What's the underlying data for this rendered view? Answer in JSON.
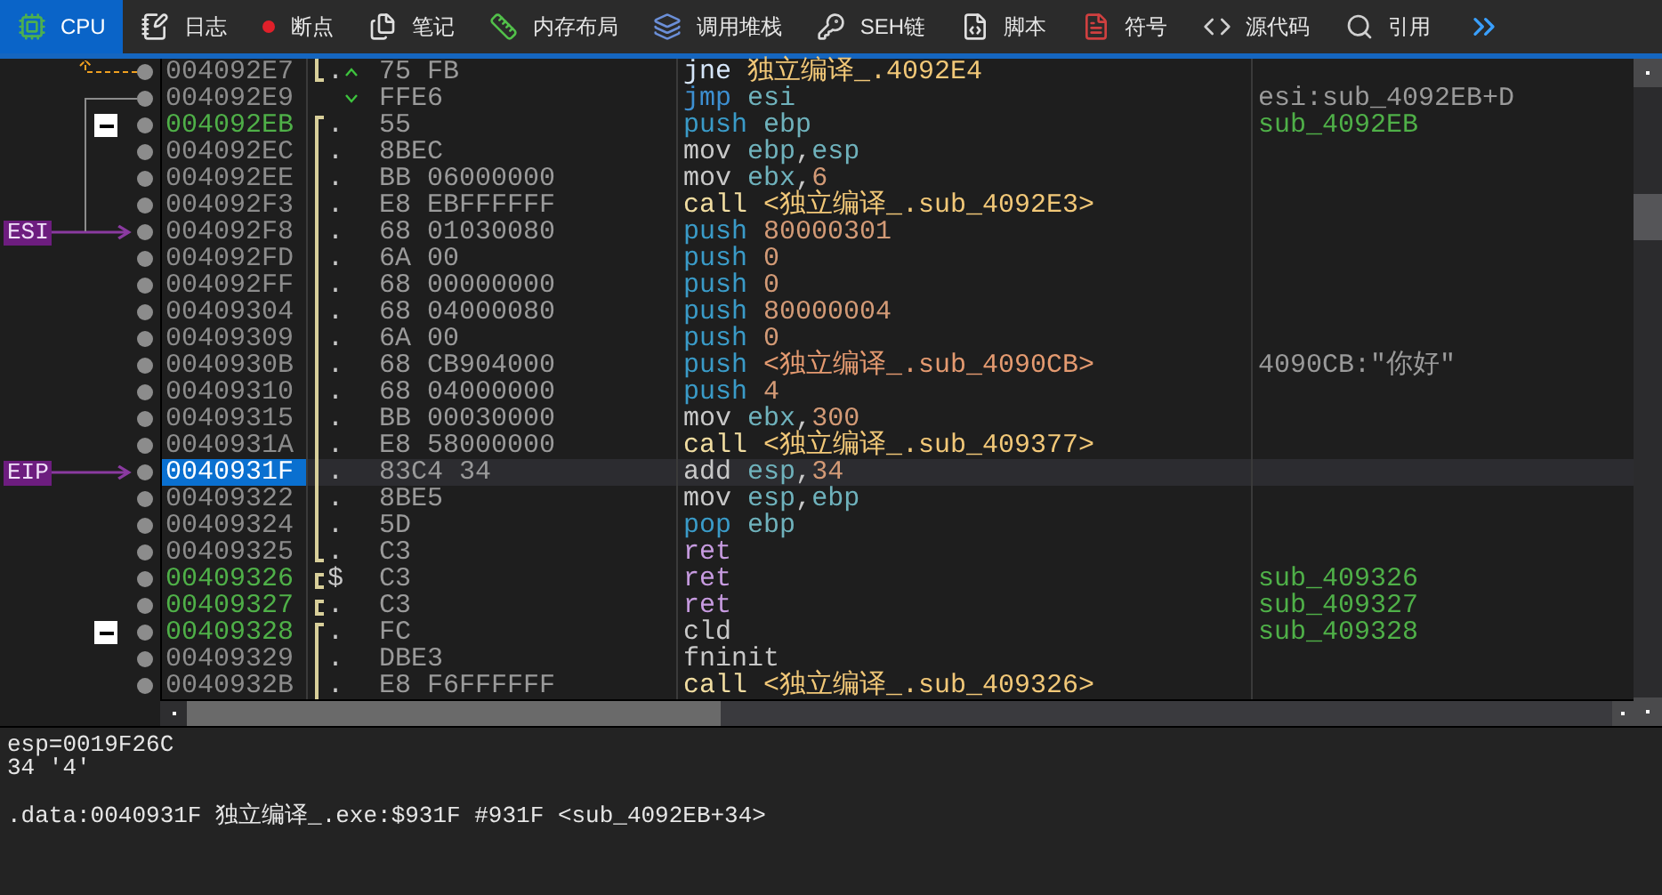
{
  "tabs": [
    {
      "label": "CPU",
      "kind": "cpu",
      "selected": true
    },
    {
      "label": "日志",
      "kind": "log",
      "selected": false
    },
    {
      "label": "断点",
      "kind": "breakpoint",
      "selected": false
    },
    {
      "label": "笔记",
      "kind": "notes",
      "selected": false
    },
    {
      "label": "内存布局",
      "kind": "memory",
      "selected": false
    },
    {
      "label": "调用堆栈",
      "kind": "stack",
      "selected": false
    },
    {
      "label": "SEH链",
      "kind": "seh",
      "selected": false
    },
    {
      "label": "脚本",
      "kind": "script",
      "selected": false
    },
    {
      "label": "符号",
      "kind": "symbol",
      "selected": false
    },
    {
      "label": "源代码",
      "kind": "source",
      "selected": false
    },
    {
      "label": "引用",
      "kind": "references",
      "selected": false
    },
    {
      "kind": "more",
      "selected": false
    }
  ],
  "rows": [
    {
      "address": "004092E7",
      "is_label": false,
      "selected": false,
      "fold": false,
      "bracket": {
        "kind": "end"
      },
      "marker": ".",
      "jump": {
        "kind": "up"
      },
      "bytes": "75 FB",
      "mnemonic": {
        "text": "jne",
        "kind": "cond_jump"
      },
      "operands": [
        {
          "text": "独立编译_.4092E4",
          "kind": "label"
        }
      ]
    },
    {
      "address": "004092E9",
      "is_label": false,
      "selected": false,
      "fold": false,
      "jump": {
        "kind": "down"
      },
      "bytes": "FFE6",
      "mnemonic": {
        "text": "jmp",
        "kind": "jump"
      },
      "operands": [
        {
          "text": "esi",
          "kind": "reg"
        }
      ],
      "comment": {
        "text": "esi:sub_4092EB+D",
        "kind": "plain"
      }
    },
    {
      "address": "004092EB",
      "is_label": true,
      "selected": false,
      "fold": true,
      "bracket": {
        "kind": "start"
      },
      "marker": ".",
      "bytes": "55",
      "mnemonic": {
        "text": "push",
        "kind": "stack"
      },
      "operands": [
        {
          "text": "ebp",
          "kind": "reg"
        }
      ],
      "comment": {
        "text": "sub_4092EB",
        "kind": "label"
      }
    },
    {
      "address": "004092EC",
      "is_label": false,
      "selected": false,
      "fold": false,
      "bracket": {
        "kind": "mid"
      },
      "marker": ".",
      "bytes": "8BEC",
      "mnemonic": {
        "text": "mov",
        "kind": "plain"
      },
      "operands": [
        {
          "text": "ebp",
          "kind": "reg"
        },
        {
          "text": ",",
          "kind": "punct"
        },
        {
          "text": "esp",
          "kind": "reg"
        }
      ]
    },
    {
      "address": "004092EE",
      "is_label": false,
      "selected": false,
      "fold": false,
      "bracket": {
        "kind": "mid"
      },
      "marker": ".",
      "bytes": "BB 06000000",
      "mnemonic": {
        "text": "mov",
        "kind": "plain"
      },
      "operands": [
        {
          "text": "ebx",
          "kind": "reg"
        },
        {
          "text": ",",
          "kind": "punct"
        },
        {
          "text": "6",
          "kind": "num"
        }
      ]
    },
    {
      "address": "004092F3",
      "is_label": false,
      "selected": false,
      "fold": false,
      "bracket": {
        "kind": "mid"
      },
      "marker": ".",
      "bytes": "E8 EBFFFFFF",
      "mnemonic": {
        "text": "call",
        "kind": "call"
      },
      "operands": [
        {
          "text": "<独立编译_.sub_4092E3>",
          "kind": "label"
        }
      ]
    },
    {
      "address": "004092F8",
      "is_label": false,
      "selected": false,
      "fold": false,
      "bracket": {
        "kind": "mid"
      },
      "marker": ".",
      "register": "ESI",
      "bytes": "68 01030080",
      "mnemonic": {
        "text": "push",
        "kind": "stack"
      },
      "operands": [
        {
          "text": "80000301",
          "kind": "num"
        }
      ]
    },
    {
      "address": "004092FD",
      "is_label": false,
      "selected": false,
      "fold": false,
      "bracket": {
        "kind": "mid"
      },
      "marker": ".",
      "bytes": "6A 00",
      "mnemonic": {
        "text": "push",
        "kind": "stack"
      },
      "operands": [
        {
          "text": "0",
          "kind": "num"
        }
      ]
    },
    {
      "address": "004092FF",
      "is_label": false,
      "selected": false,
      "fold": false,
      "bracket": {
        "kind": "mid"
      },
      "marker": ".",
      "bytes": "68 00000000",
      "mnemonic": {
        "text": "push",
        "kind": "stack"
      },
      "operands": [
        {
          "text": "0",
          "kind": "num"
        }
      ]
    },
    {
      "address": "00409304",
      "is_label": false,
      "selected": false,
      "fold": false,
      "bracket": {
        "kind": "mid"
      },
      "marker": ".",
      "bytes": "68 04000080",
      "mnemonic": {
        "text": "push",
        "kind": "stack"
      },
      "operands": [
        {
          "text": "80000004",
          "kind": "num"
        }
      ]
    },
    {
      "address": "00409309",
      "is_label": false,
      "selected": false,
      "fold": false,
      "bracket": {
        "kind": "mid"
      },
      "marker": ".",
      "bytes": "6A 00",
      "mnemonic": {
        "text": "push",
        "kind": "stack"
      },
      "operands": [
        {
          "text": "0",
          "kind": "num"
        }
      ]
    },
    {
      "address": "0040930B",
      "is_label": false,
      "selected": false,
      "fold": false,
      "bracket": {
        "kind": "mid"
      },
      "marker": ".",
      "bytes": "68 CB904000",
      "mnemonic": {
        "text": "push",
        "kind": "stack"
      },
      "operands": [
        {
          "text": "<独立编译_.sub_4090CB>",
          "kind": "address"
        }
      ],
      "comment": {
        "text": "4090CB:\"你好\"",
        "kind": "plain"
      }
    },
    {
      "address": "00409310",
      "is_label": false,
      "selected": false,
      "fold": false,
      "bracket": {
        "kind": "mid"
      },
      "marker": ".",
      "bytes": "68 04000000",
      "mnemonic": {
        "text": "push",
        "kind": "stack"
      },
      "operands": [
        {
          "text": "4",
          "kind": "num"
        }
      ]
    },
    {
      "address": "00409315",
      "is_label": false,
      "selected": false,
      "fold": false,
      "bracket": {
        "kind": "mid"
      },
      "marker": ".",
      "bytes": "BB 00030000",
      "mnemonic": {
        "text": "mov",
        "kind": "plain"
      },
      "operands": [
        {
          "text": "ebx",
          "kind": "reg"
        },
        {
          "text": ",",
          "kind": "punct"
        },
        {
          "text": "300",
          "kind": "num"
        }
      ]
    },
    {
      "address": "0040931A",
      "is_label": false,
      "selected": false,
      "fold": false,
      "bracket": {
        "kind": "mid"
      },
      "marker": ".",
      "bytes": "E8 58000000",
      "mnemonic": {
        "text": "call",
        "kind": "call"
      },
      "operands": [
        {
          "text": "<独立编译_.sub_409377>",
          "kind": "label"
        }
      ]
    },
    {
      "address": "0040931F",
      "is_label": false,
      "selected": true,
      "fold": false,
      "bracket": {
        "kind": "mid"
      },
      "marker": ".",
      "register": "EIP",
      "bytes": "83C4 34",
      "mnemonic": {
        "text": "add",
        "kind": "plain"
      },
      "operands": [
        {
          "text": "esp",
          "kind": "reg"
        },
        {
          "text": ",",
          "kind": "punct"
        },
        {
          "text": "34",
          "kind": "num"
        }
      ]
    },
    {
      "address": "00409322",
      "is_label": false,
      "selected": false,
      "fold": false,
      "bracket": {
        "kind": "mid"
      },
      "marker": ".",
      "bytes": "8BE5",
      "mnemonic": {
        "text": "mov",
        "kind": "plain"
      },
      "operands": [
        {
          "text": "esp",
          "kind": "reg"
        },
        {
          "text": ",",
          "kind": "punct"
        },
        {
          "text": "ebp",
          "kind": "reg"
        }
      ]
    },
    {
      "address": "00409324",
      "is_label": false,
      "selected": false,
      "fold": false,
      "bracket": {
        "kind": "mid"
      },
      "marker": ".",
      "bytes": "5D",
      "mnemonic": {
        "text": "pop",
        "kind": "stack"
      },
      "operands": [
        {
          "text": "ebp",
          "kind": "reg"
        }
      ]
    },
    {
      "address": "00409325",
      "is_label": false,
      "selected": false,
      "fold": false,
      "bracket": {
        "kind": "end"
      },
      "marker": ".",
      "bytes": "C3",
      "mnemonic": {
        "text": "ret",
        "kind": "ret"
      },
      "operands": []
    },
    {
      "address": "00409326",
      "is_label": true,
      "selected": false,
      "fold": false,
      "bracket": {
        "kind": "single"
      },
      "marker": "$",
      "bytes": "C3",
      "mnemonic": {
        "text": "ret",
        "kind": "ret"
      },
      "operands": [],
      "comment": {
        "text": "sub_409326",
        "kind": "label"
      }
    },
    {
      "address": "00409327",
      "is_label": true,
      "selected": false,
      "fold": false,
      "bracket": {
        "kind": "single"
      },
      "marker": ".",
      "bytes": "C3",
      "mnemonic": {
        "text": "ret",
        "kind": "ret"
      },
      "operands": [],
      "comment": {
        "text": "sub_409327",
        "kind": "label"
      }
    },
    {
      "address": "00409328",
      "is_label": true,
      "selected": false,
      "fold": true,
      "bracket": {
        "kind": "start"
      },
      "marker": ".",
      "bytes": "FC",
      "mnemonic": {
        "text": "cld",
        "kind": "plain"
      },
      "operands": [],
      "comment": {
        "text": "sub_409328",
        "kind": "label"
      }
    },
    {
      "address": "00409329",
      "is_label": false,
      "selected": false,
      "fold": false,
      "bracket": {
        "kind": "mid"
      },
      "marker": ".",
      "bytes": "DBE3",
      "mnemonic": {
        "text": "fninit",
        "kind": "plain"
      },
      "operands": []
    },
    {
      "address": "0040932B",
      "is_label": false,
      "selected": false,
      "fold": false,
      "bracket": {
        "kind": "mid"
      },
      "marker": ".",
      "bytes": "E8 F6FFFFFF",
      "mnemonic": {
        "text": "call",
        "kind": "call"
      },
      "operands": [
        {
          "text": "<独立编译_.sub_409326>",
          "kind": "label"
        }
      ]
    }
  ],
  "info_panel": {
    "lines": [
      "esp=0019F26C",
      "34 '4'"
    ],
    "location": ".data:0040931F 独立编译_.exe:$931F #931F <sub_4092EB+34>"
  }
}
